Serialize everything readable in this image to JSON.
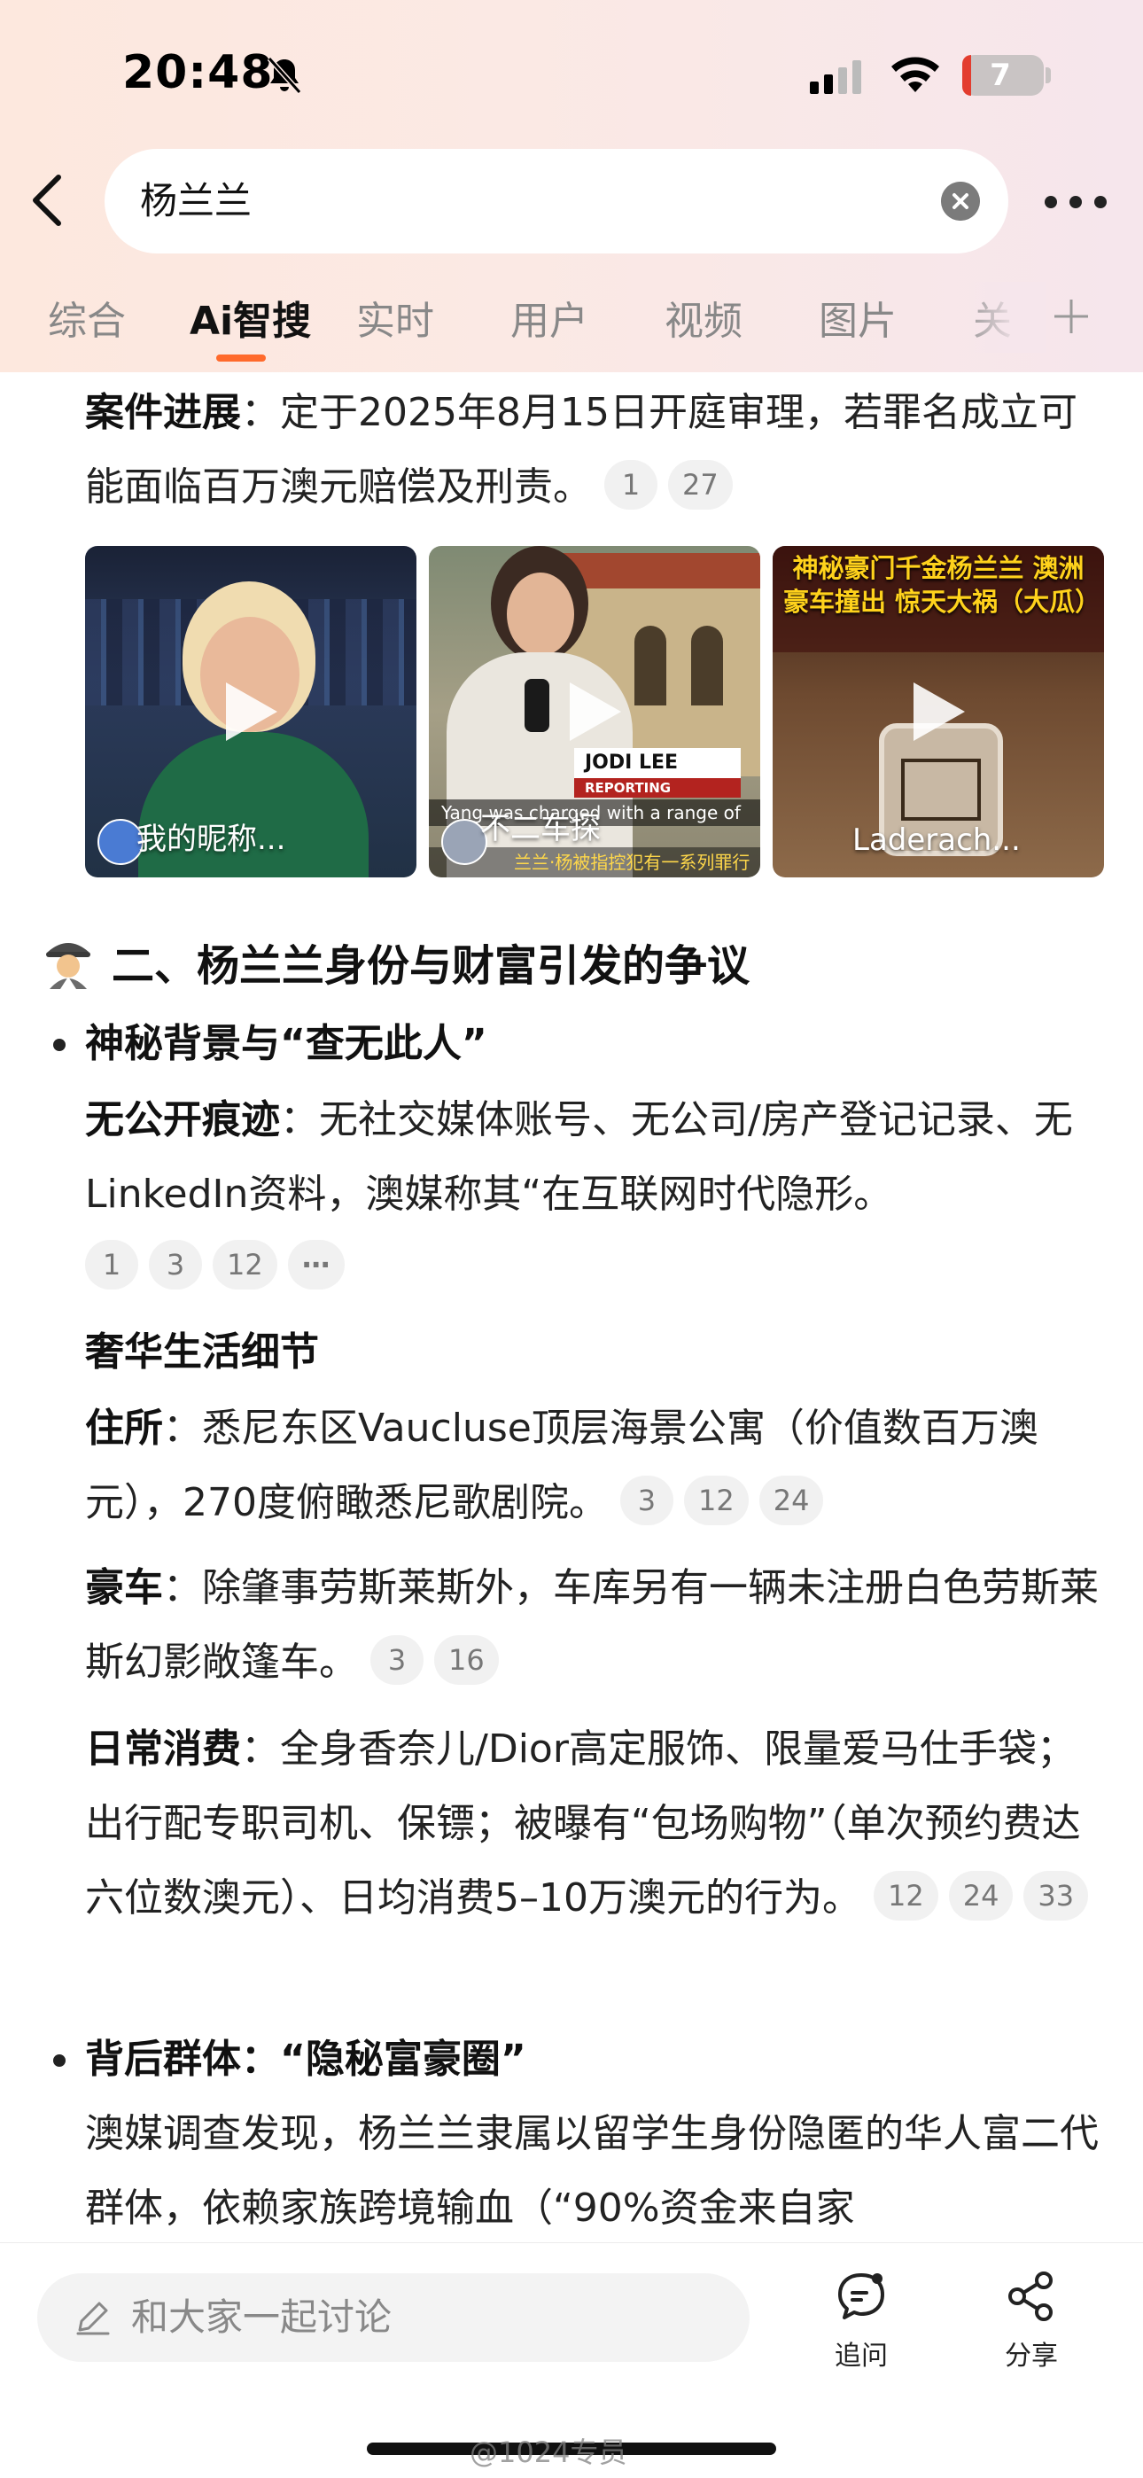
{
  "status_bar": {
    "time": "20:48",
    "battery": "7"
  },
  "search": {
    "query": "杨兰兰"
  },
  "tabs": [
    {
      "label": "综合"
    },
    {
      "label": "Ai智搜"
    },
    {
      "label": "实时"
    },
    {
      "label": "用户"
    },
    {
      "label": "视频"
    },
    {
      "label": "图片"
    },
    {
      "label": "关"
    }
  ],
  "case_progress": {
    "label": "案件进展",
    "text": "：定于2025年8月15日开庭审理，若罪名成立可能面临百万澳元赔偿及刑责。",
    "cites": [
      "1",
      "27"
    ]
  },
  "videos": [
    {
      "title": "我的昵称..."
    },
    {
      "title": "不二车探",
      "overlay_name": "JODI LEE",
      "overlay_role": "REPORTING",
      "caption": "Yang was charged with a range of",
      "caption2": "兰兰·杨被指控犯有一系列罪行"
    },
    {
      "title": "Laderach...",
      "overlay": "神秘豪门千金杨兰兰 澳洲豪车撞出 惊天大祸（大瓜）"
    }
  ],
  "section2": {
    "icon": "detective-icon",
    "title": "二、杨兰兰身份与财富引发的争议"
  },
  "bullet1": {
    "title": "神秘背景与“查无此人”",
    "no_trace_label": "无公开痕迹",
    "no_trace_text": "：无社交媒体账号、无公司/房产登记记录、无LinkedIn资料，澳媒称其“在互联网时代隐形。",
    "no_trace_cites": [
      "1",
      "3",
      "12",
      "⋯"
    ]
  },
  "luxury": {
    "title": "奢华生活细节",
    "residence_label": "住所",
    "residence_text": "：悉尼东区Vaucluse顶层海景公寓（价值数百万澳元），270度俯瞰悉尼歌剧院。",
    "residence_cites": [
      "3",
      "12",
      "24"
    ],
    "car_label": "豪车",
    "car_text": "：除肇事劳斯莱斯外，车库另有一辆未注册白色劳斯莱斯幻影敞篷车。",
    "car_cites": [
      "3",
      "16"
    ],
    "spend_label": "日常消费",
    "spend_text": "：全身香奈儿/Dior高定服饰、限量爱马仕手袋；出行配专职司机、保镖；被曝有“包场购物”（单次预约费达六位数澳元）、日均消费5–10万澳元的行为。",
    "spend_cites": [
      "12",
      "24",
      "33"
    ]
  },
  "bullet2": {
    "title": "背后群体：“隐秘富豪圈”",
    "text": "澳媒调查发现，杨兰兰隶属以留学生身份隐匿的华人富二代群体，依赖家族跨境输血（“90%资金来自家"
  },
  "bottom": {
    "discuss_placeholder": "和大家一起讨论",
    "followup_label": "追问",
    "share_label": "分享"
  },
  "watermark": "@1024专员"
}
